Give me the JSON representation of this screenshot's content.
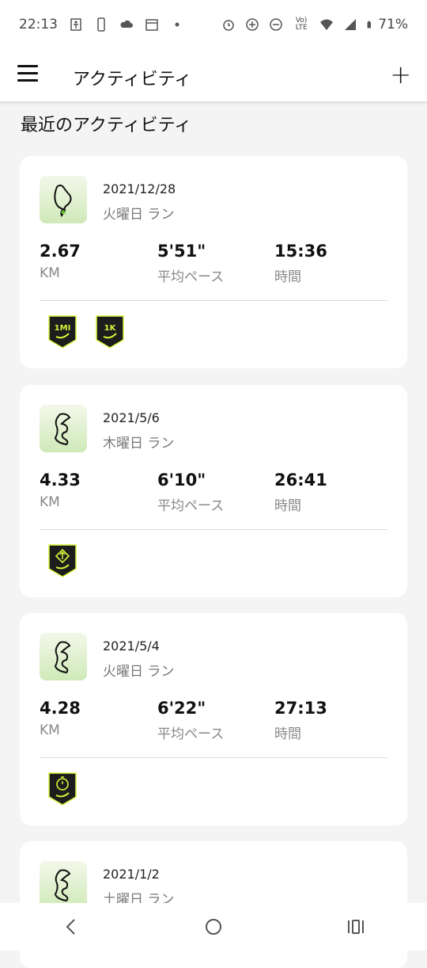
{
  "status_bar": {
    "time": "22:13",
    "battery": "71%",
    "network": "Vo) LTE"
  },
  "app_bar": {
    "title": "アクティビティ",
    "menu_icon": "hamburger-icon",
    "add_icon": "plus-icon"
  },
  "section": {
    "title": "最近のアクティビティ"
  },
  "activities": [
    {
      "date": "2021/12/28",
      "day": "火曜日 ラン",
      "distance": "2.67",
      "distance_label": "KM",
      "pace": "5'51\"",
      "pace_label": "平均ペース",
      "duration": "15:36",
      "duration_label": "時間",
      "badges": [
        "1MI",
        "1K"
      ]
    },
    {
      "date": "2021/5/6",
      "day": "木曜日 ラン",
      "distance": "4.33",
      "distance_label": "KM",
      "pace": "6'10\"",
      "pace_label": "平均ペース",
      "duration": "26:41",
      "duration_label": "時間",
      "badges": [
        "direction-badge"
      ]
    },
    {
      "date": "2021/5/4",
      "day": "火曜日 ラン",
      "distance": "4.28",
      "distance_label": "KM",
      "pace": "6'22\"",
      "pace_label": "平均ペース",
      "duration": "27:13",
      "duration_label": "時間",
      "badges": [
        "stopwatch-badge"
      ]
    },
    {
      "date": "2021/1/2",
      "day": "土曜日 ラン"
    }
  ],
  "colors": {
    "badge_dark": "#1d1d1d",
    "badge_accent": "#d7f53a",
    "thumb_green": "#cfe9b8"
  }
}
